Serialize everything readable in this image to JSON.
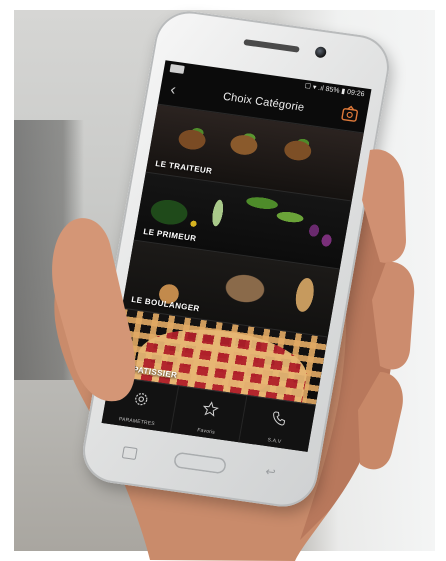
{
  "status_bar": {
    "text": "☐ ▾ .ıl 85% ▮ 09:26"
  },
  "header": {
    "title": "Choix Catégorie",
    "back_icon": "chevron-left-icon",
    "logo_icon": "oven-logo-icon"
  },
  "categories": [
    {
      "label": "LE TRAITEUR"
    },
    {
      "label": "LE PRIMEUR"
    },
    {
      "label": "LE BOULANGER"
    },
    {
      "label": "LE PATISSIER"
    }
  ],
  "bottom_nav": [
    {
      "label": "PARAMETRES",
      "icon": "gear-icon"
    },
    {
      "label": "Favoris",
      "icon": "star-icon"
    },
    {
      "label": "S.A.V",
      "icon": "phone-icon"
    }
  ],
  "colors": {
    "screen_bg": "#0b0b0b",
    "phone_body": "#e2e3e3"
  }
}
